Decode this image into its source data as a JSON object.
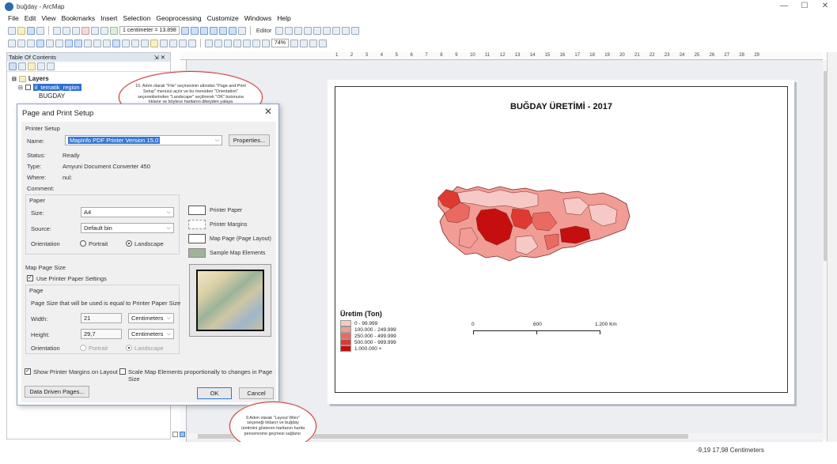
{
  "window": {
    "title": "buğday - ArcMap",
    "minimize": "—",
    "maximize": "☐",
    "close": "✕"
  },
  "menu": [
    "File",
    "Edit",
    "View",
    "Bookmarks",
    "Insert",
    "Selection",
    "Geoprocessing",
    "Customize",
    "Windows",
    "Help"
  ],
  "toolbar": {
    "scale_value": "1 centimeter = 13.898",
    "editor_label": "Editor",
    "zoom_value": "74%"
  },
  "toc": {
    "title": "Table Of Contents",
    "pin": "⇲ ✕",
    "layers_label": "Layers",
    "layer_name": "il_tematik_region",
    "field_name": "BUGDAY"
  },
  "ruler": {
    "ticks": [
      "1",
      "2",
      "3",
      "4",
      "5",
      "6",
      "7",
      "8",
      "9",
      "10",
      "11",
      "12",
      "13",
      "14",
      "15",
      "16",
      "17",
      "18",
      "19",
      "20",
      "21",
      "22",
      "23",
      "24",
      "25",
      "26",
      "27",
      "28",
      "29"
    ]
  },
  "map": {
    "title": "BUĞDAY ÜRETİMİ - 2017",
    "legend_title": "Üretim (Ton)",
    "legend": [
      {
        "label": "0 - 99.999",
        "color": "#f6c9c6"
      },
      {
        "label": "100.000 - 249.999",
        "color": "#f19d96"
      },
      {
        "label": "250.000 - 499.999",
        "color": "#e96a61"
      },
      {
        "label": "500.000 - 999.999",
        "color": "#de3a31"
      },
      {
        "label": "1.000.000 +",
        "color": "#c50f0f"
      }
    ],
    "scale_labels": [
      "0",
      "600",
      "1.200 Km"
    ]
  },
  "dialog": {
    "title": "Page and Print Setup",
    "printer_setup_label": "Printer Setup",
    "name_label": "Name:",
    "name_value": "MapInfo PDF Printer Version 15.0",
    "properties_button": "Properties...",
    "status_label": "Status:",
    "status_value": "Ready",
    "type_label": "Type:",
    "type_value": "Amyuni Document Converter 450",
    "where_label": "Where:",
    "where_value": "nul:",
    "comment_label": "Comment:",
    "paper_label": "Paper",
    "size_label": "Size:",
    "size_value": "A4",
    "source_label": "Source:",
    "source_value": "Default bin",
    "orientation_label": "Orientation",
    "portrait_label": "Portrait",
    "landscape_label": "Landscape",
    "legend_printer_paper": "Printer Paper",
    "legend_printer_margins": "Printer Margins",
    "legend_map_page": "Map Page (Page Layout)",
    "legend_sample": "Sample Map Elements",
    "map_page_size_label": "Map Page Size",
    "use_printer_settings": "Use Printer Paper Settings",
    "page_label": "Page",
    "page_size_text": "Page Size that will be used is equal to Printer Paper Size",
    "width_label": "Width:",
    "width_value": "21",
    "height_label": "Height:",
    "height_value": "29,7",
    "units_value": "Centimeters",
    "orientation2_label": "Orientation",
    "show_margins": "Show Printer Margins on Layout",
    "scale_elements": "Scale Map Elements proportionally to changes in Page Size",
    "data_driven_button": "Data Driven Pages...",
    "ok_button": "OK",
    "cancel_button": "Cancel"
  },
  "callouts": {
    "top": "10. Adım olarak \"File\" seçmesinin altından \"Page and Print Setup\" menüsü açılır ve bu menüden \"Orientation\" seçeneklerinden \"Landscape\" seçilirerek \"OK\" butonuna tıklanır ve böylece haritanın dikeyden yataya dönüştürülmesi sağlanır.",
    "bottom": "9.Adım olarak \"Layout Wiev\" seçeneği tıklanır ve buğday üretimini gösteren haritanın harita penceresine geçmesi sağlanır."
  },
  "status": {
    "coords": "-9,19  17,98 Centimeters"
  }
}
